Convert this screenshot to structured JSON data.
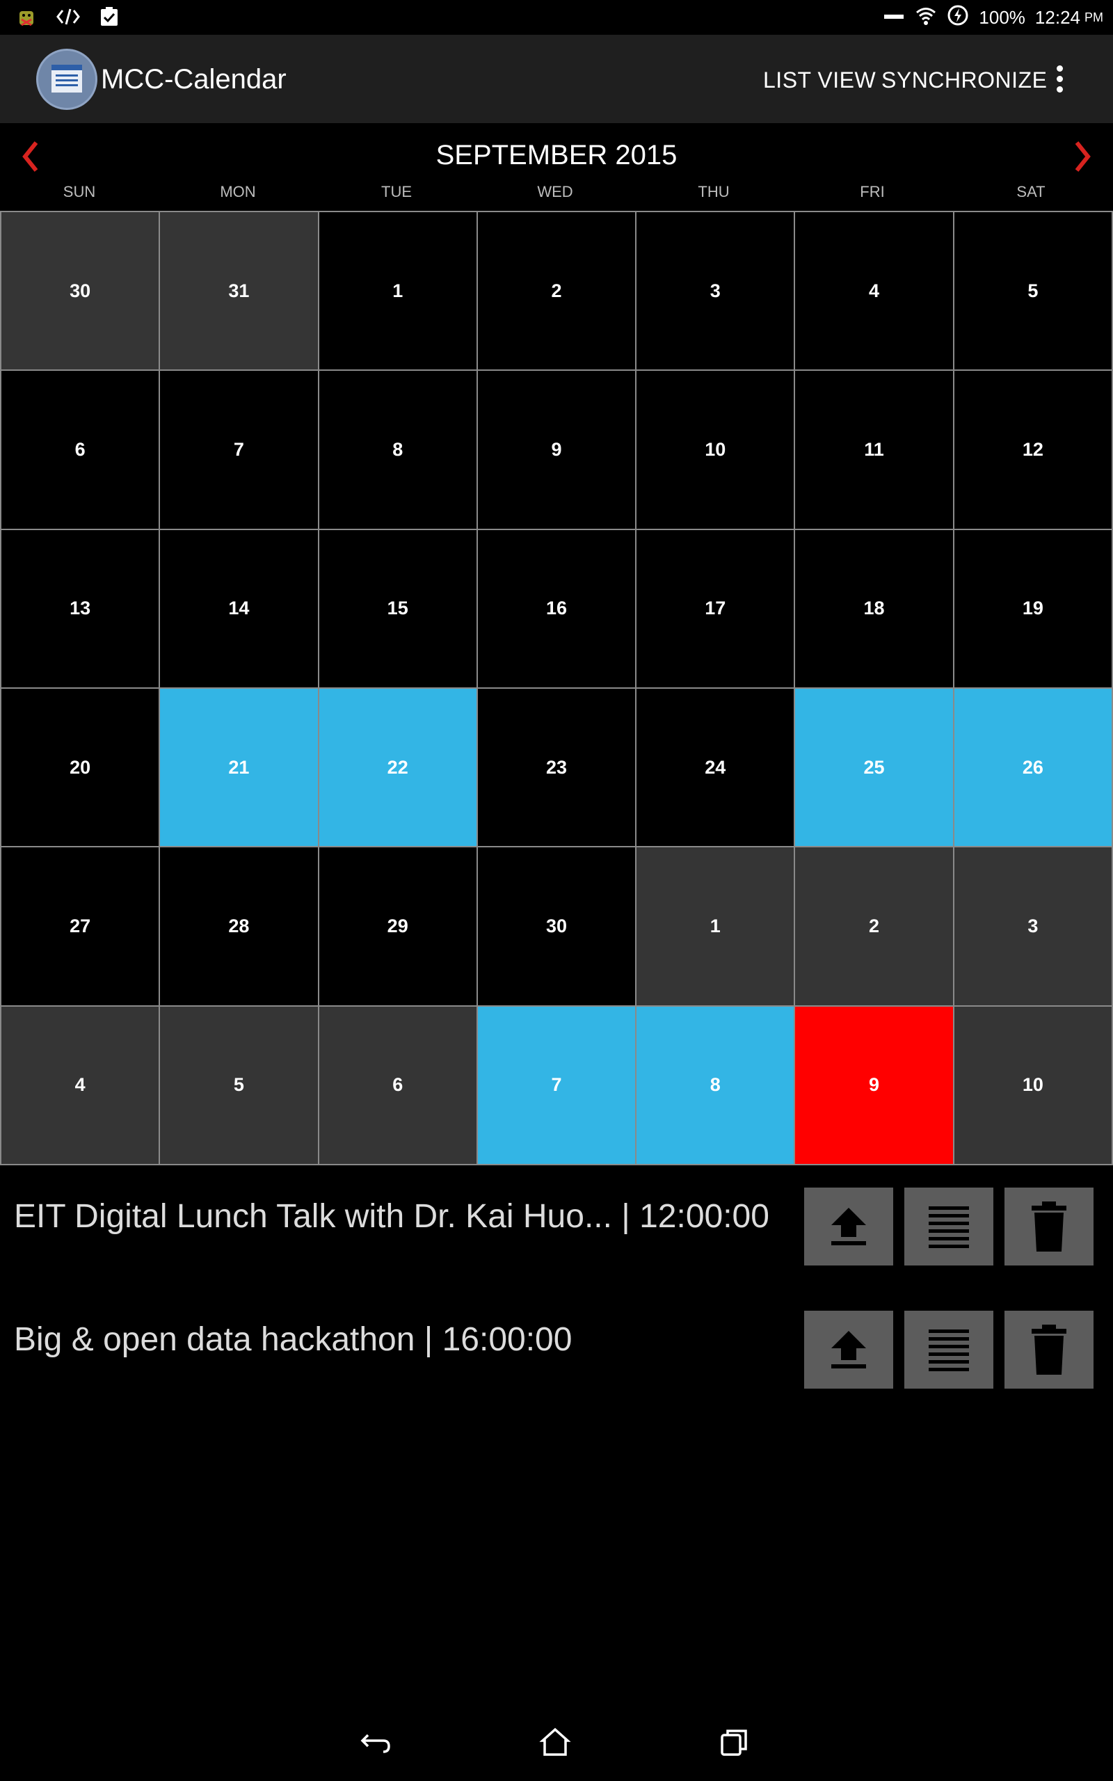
{
  "status_bar": {
    "left_icons": [
      "android-debug-icon",
      "code-icon",
      "clipboard-check-icon"
    ],
    "battery": "100%",
    "time": "12:24",
    "ampm": "PM"
  },
  "action_bar": {
    "title": "MCC-Calendar",
    "list_view": "LIST VIEW",
    "synchronize": "SYNCHRONIZE"
  },
  "calendar": {
    "month_title": "SEPTEMBER 2015",
    "weekdays": [
      "SUN",
      "MON",
      "TUE",
      "WED",
      "THU",
      "FRI",
      "SAT"
    ],
    "colors": {
      "current_month": "#000000",
      "other_month": "#353535",
      "event": "#33b5e5",
      "today": "#ff0000"
    },
    "days": [
      {
        "label": "30",
        "state": "other"
      },
      {
        "label": "31",
        "state": "other"
      },
      {
        "label": "1",
        "state": "current"
      },
      {
        "label": "2",
        "state": "current"
      },
      {
        "label": "3",
        "state": "current"
      },
      {
        "label": "4",
        "state": "current"
      },
      {
        "label": "5",
        "state": "current"
      },
      {
        "label": "6",
        "state": "current"
      },
      {
        "label": "7",
        "state": "current"
      },
      {
        "label": "8",
        "state": "current"
      },
      {
        "label": "9",
        "state": "current"
      },
      {
        "label": "10",
        "state": "current"
      },
      {
        "label": "11",
        "state": "current"
      },
      {
        "label": "12",
        "state": "current"
      },
      {
        "label": "13",
        "state": "current"
      },
      {
        "label": "14",
        "state": "current"
      },
      {
        "label": "15",
        "state": "current"
      },
      {
        "label": "16",
        "state": "current"
      },
      {
        "label": "17",
        "state": "current"
      },
      {
        "label": "18",
        "state": "current"
      },
      {
        "label": "19",
        "state": "current"
      },
      {
        "label": "20",
        "state": "current"
      },
      {
        "label": "21",
        "state": "event"
      },
      {
        "label": "22",
        "state": "event"
      },
      {
        "label": "23",
        "state": "current"
      },
      {
        "label": "24",
        "state": "current"
      },
      {
        "label": "25",
        "state": "event"
      },
      {
        "label": "26",
        "state": "event"
      },
      {
        "label": "27",
        "state": "current"
      },
      {
        "label": "28",
        "state": "current"
      },
      {
        "label": "29",
        "state": "current"
      },
      {
        "label": "30",
        "state": "current"
      },
      {
        "label": "1",
        "state": "other"
      },
      {
        "label": "2",
        "state": "other"
      },
      {
        "label": "3",
        "state": "other"
      },
      {
        "label": "4",
        "state": "other"
      },
      {
        "label": "5",
        "state": "other"
      },
      {
        "label": "6",
        "state": "other"
      },
      {
        "label": "7",
        "state": "event"
      },
      {
        "label": "8",
        "state": "event"
      },
      {
        "label": "9",
        "state": "today"
      },
      {
        "label": "10",
        "state": "other"
      }
    ]
  },
  "events": [
    {
      "text": "EIT Digital Lunch Talk with Dr. Kai Huo...  | 12:00:00"
    },
    {
      "text": "Big & open data hackathon  | 16:00:00"
    }
  ],
  "event_actions": [
    "upload-icon",
    "details-list-icon",
    "trash-icon"
  ],
  "nav_bar": [
    "back-icon",
    "home-icon",
    "recents-icon"
  ]
}
